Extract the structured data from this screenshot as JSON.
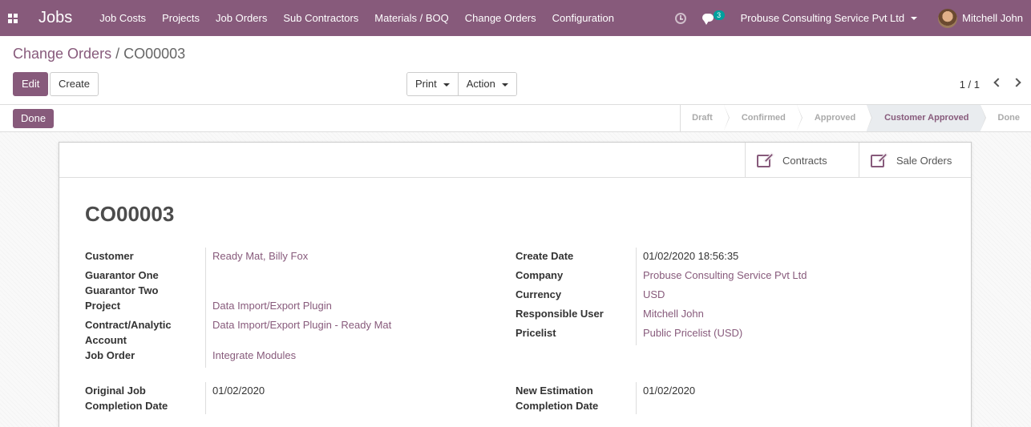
{
  "app": {
    "title": "Jobs"
  },
  "menu": [
    "Job Costs",
    "Projects",
    "Job Orders",
    "Sub Contractors",
    "Materials / BOQ",
    "Change Orders",
    "Configuration"
  ],
  "navbar": {
    "chat_count": "3",
    "company": "Probuse Consulting Service Pvt Ltd",
    "user": "Mitchell John"
  },
  "breadcrumb": {
    "parent": "Change Orders",
    "separator": "/",
    "current": "CO00003"
  },
  "toolbar": {
    "edit": "Edit",
    "create": "Create",
    "print": "Print",
    "action": "Action"
  },
  "pager": {
    "value": "1 / 1"
  },
  "status": {
    "done_button": "Done",
    "stages": [
      "Draft",
      "Confirmed",
      "Approved",
      "Customer Approved",
      "Done"
    ],
    "active": "Customer Approved"
  },
  "smart_buttons": {
    "contracts": "Contracts",
    "sale_orders": "Sale Orders"
  },
  "record": {
    "name": "CO00003",
    "left_fields": {
      "customer_label": "Customer",
      "customer": "Ready Mat, Billy Fox",
      "guarantor_one_label": "Guarantor One",
      "guarantor_two_label": "Guarantor Two",
      "project_label": "Project",
      "project": "Data Import/Export Plugin",
      "contract_label_1": "Contract/Analytic",
      "contract_label_2": "Account",
      "contract": "Data Import/Export Plugin - Ready Mat",
      "job_order_label": "Job Order",
      "job_order": "Integrate Modules",
      "original_completion_label_1": "Original Job",
      "original_completion_label_2": "Completion Date",
      "original_completion": "01/02/2020"
    },
    "right_fields": {
      "create_date_label": "Create Date",
      "create_date": "01/02/2020 18:56:35",
      "company_label": "Company",
      "company": "Probuse Consulting Service Pvt Ltd",
      "currency_label": "Currency",
      "currency": "USD",
      "responsible_label": "Responsible User",
      "responsible": "Mitchell John",
      "pricelist_label": "Pricelist",
      "pricelist": "Public Pricelist (USD)",
      "new_completion_label_1": "New Estimation",
      "new_completion_label_2": "Completion Date",
      "new_completion": "01/02/2020"
    }
  },
  "colors": {
    "brand": "#875a7b",
    "badge": "#00a09d"
  }
}
